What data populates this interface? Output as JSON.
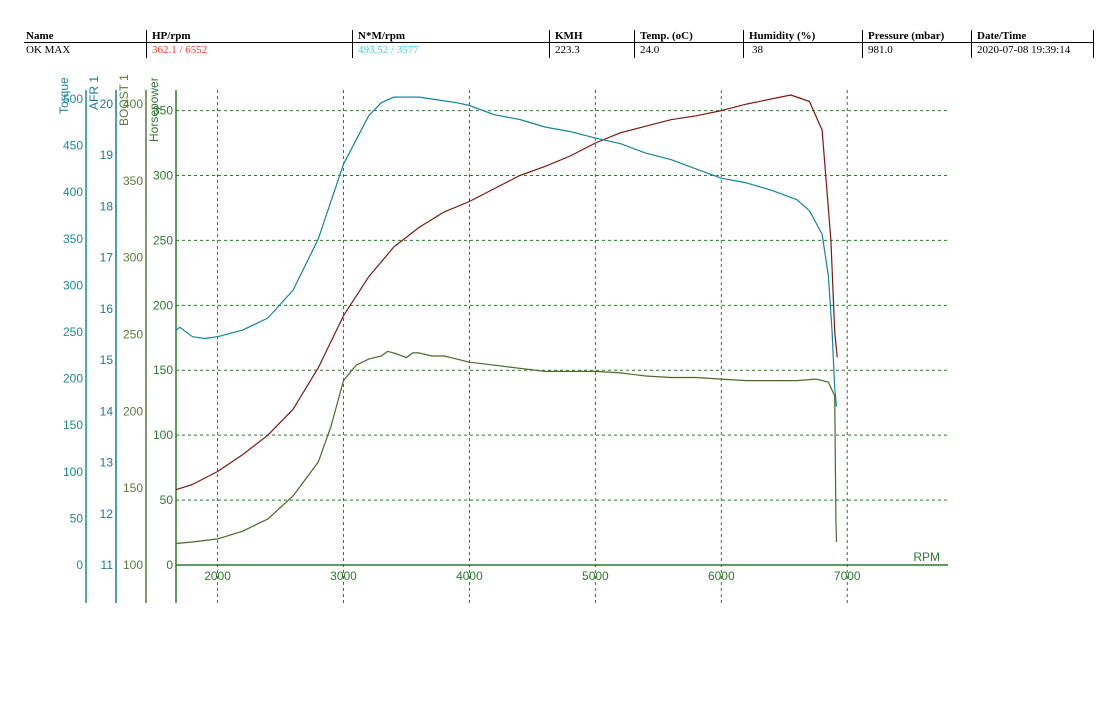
{
  "header": {
    "columns": [
      "Name",
      "HP/rpm",
      "N*M/rpm",
      "KMH",
      "Temp. (oC)",
      "Humidity (%)",
      "Pressure (mbar)",
      "Date/Time"
    ],
    "name": "OK MAX",
    "hp_rpm": "362.1 / 6552",
    "nm_rpm": "493.52 / 3577",
    "kmh": "223.3",
    "temp": "24.0",
    "humidity": "38",
    "pressure": "981.0",
    "datetime": "2020-07-08 19:39:14"
  },
  "colors": {
    "hp": "#e8402a",
    "torque": "#3fd0e8",
    "torque_axis": "#1a8a96",
    "afr_axis": "#1a7a96",
    "boost_axis": "#5a7a3a",
    "hp_axis": "#2e7a2e",
    "rpm_axis": "#2e7a2e",
    "hp_curve": "#7a1a12",
    "torque_curve": "#138598",
    "boost_curve": "#4a6a2a",
    "grid": "#2e7a2e"
  },
  "chart_data": {
    "type": "line",
    "xlabel": "RPM",
    "xlim": [
      1670,
      7800
    ],
    "x_ticks": [
      2000,
      3000,
      4000,
      5000,
      6000,
      7000
    ],
    "grid": true,
    "axes": {
      "torque": {
        "label": "Torque",
        "ticks": [
          0,
          50,
          100,
          150,
          200,
          250,
          300,
          350,
          400,
          450,
          500
        ],
        "range": [
          0,
          500
        ]
      },
      "afr": {
        "label": "AFR 1",
        "ticks": [
          11,
          12,
          13,
          14,
          15,
          16,
          17,
          18,
          19,
          20
        ],
        "range": [
          11,
          20
        ]
      },
      "boost": {
        "label": "BOOST 1",
        "ticks": [
          100,
          150,
          200,
          250,
          300,
          350,
          400
        ],
        "range": [
          100,
          400
        ]
      },
      "horsepower": {
        "label": "Horsepower",
        "ticks": [
          0,
          50,
          100,
          150,
          200,
          250,
          300,
          350
        ],
        "range": [
          0,
          362
        ]
      }
    },
    "series": [
      {
        "key": "horsepower",
        "axis": "horsepower",
        "points": [
          [
            1670,
            58
          ],
          [
            1800,
            62
          ],
          [
            2000,
            72
          ],
          [
            2200,
            85
          ],
          [
            2400,
            100
          ],
          [
            2600,
            120
          ],
          [
            2800,
            152
          ],
          [
            3000,
            192
          ],
          [
            3200,
            222
          ],
          [
            3400,
            245
          ],
          [
            3600,
            260
          ],
          [
            3800,
            272
          ],
          [
            4000,
            280
          ],
          [
            4200,
            290
          ],
          [
            4400,
            300
          ],
          [
            4600,
            307
          ],
          [
            4800,
            315
          ],
          [
            5000,
            325
          ],
          [
            5200,
            333
          ],
          [
            5400,
            338
          ],
          [
            5600,
            343
          ],
          [
            5800,
            346
          ],
          [
            6000,
            350
          ],
          [
            6200,
            355
          ],
          [
            6400,
            359
          ],
          [
            6552,
            362
          ],
          [
            6700,
            357
          ],
          [
            6800,
            335
          ],
          [
            6870,
            250
          ],
          [
            6900,
            180
          ],
          [
            6920,
            160
          ]
        ]
      },
      {
        "key": "torque",
        "axis": "torque",
        "points": [
          [
            1670,
            252
          ],
          [
            1700,
            255
          ],
          [
            1800,
            245
          ],
          [
            1900,
            243
          ],
          [
            2000,
            245
          ],
          [
            2200,
            252
          ],
          [
            2400,
            265
          ],
          [
            2600,
            295
          ],
          [
            2800,
            350
          ],
          [
            3000,
            430
          ],
          [
            3200,
            482
          ],
          [
            3300,
            496
          ],
          [
            3400,
            502
          ],
          [
            3500,
            502
          ],
          [
            3600,
            502
          ],
          [
            3700,
            500
          ],
          [
            3800,
            498
          ],
          [
            3900,
            496
          ],
          [
            4000,
            493
          ],
          [
            4200,
            483
          ],
          [
            4400,
            478
          ],
          [
            4600,
            470
          ],
          [
            4800,
            465
          ],
          [
            5000,
            458
          ],
          [
            5200,
            452
          ],
          [
            5400,
            442
          ],
          [
            5600,
            435
          ],
          [
            5800,
            425
          ],
          [
            6000,
            415
          ],
          [
            6200,
            410
          ],
          [
            6400,
            402
          ],
          [
            6600,
            392
          ],
          [
            6700,
            380
          ],
          [
            6800,
            355
          ],
          [
            6850,
            310
          ],
          [
            6880,
            250
          ],
          [
            6900,
            190
          ],
          [
            6915,
            170
          ]
        ]
      },
      {
        "key": "boost",
        "axis": "boost",
        "points": [
          [
            1670,
            114
          ],
          [
            1800,
            115
          ],
          [
            2000,
            117
          ],
          [
            2200,
            122
          ],
          [
            2400,
            130
          ],
          [
            2600,
            145
          ],
          [
            2800,
            167
          ],
          [
            2900,
            190
          ],
          [
            3000,
            220
          ],
          [
            3100,
            230
          ],
          [
            3200,
            234
          ],
          [
            3300,
            236
          ],
          [
            3350,
            239
          ],
          [
            3400,
            238
          ],
          [
            3500,
            235
          ],
          [
            3550,
            238
          ],
          [
            3600,
            238
          ],
          [
            3700,
            236
          ],
          [
            3800,
            236
          ],
          [
            3900,
            234
          ],
          [
            4000,
            232
          ],
          [
            4200,
            230
          ],
          [
            4400,
            228
          ],
          [
            4600,
            226
          ],
          [
            4800,
            226
          ],
          [
            5000,
            226
          ],
          [
            5200,
            225
          ],
          [
            5400,
            223
          ],
          [
            5600,
            222
          ],
          [
            5800,
            222
          ],
          [
            6000,
            221
          ],
          [
            6200,
            220
          ],
          [
            6400,
            220
          ],
          [
            6600,
            220
          ],
          [
            6750,
            221
          ],
          [
            6850,
            219
          ],
          [
            6900,
            210
          ],
          [
            6910,
            130
          ],
          [
            6915,
            115
          ]
        ]
      }
    ]
  }
}
